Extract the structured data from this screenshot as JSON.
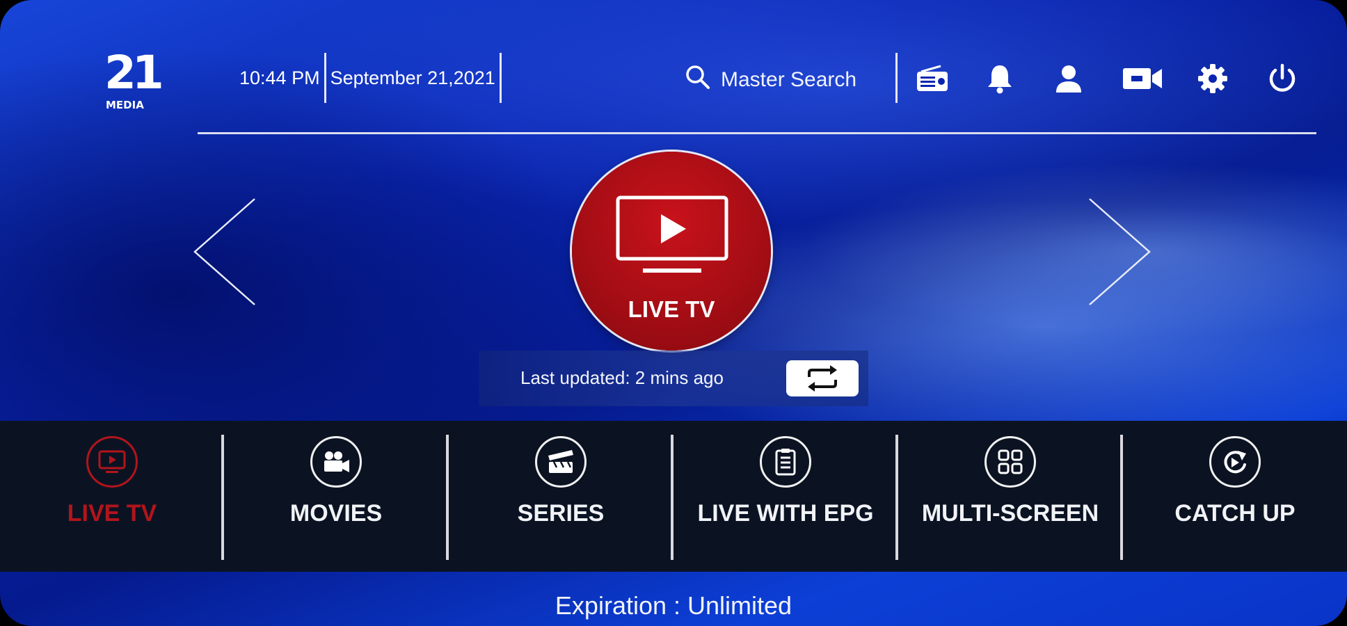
{
  "brand": {
    "logo_number": "21",
    "logo_text": "MEDIA"
  },
  "header": {
    "time": "10:44 PM",
    "date": "September 21,2021",
    "search_label": "Master Search",
    "icons": [
      "radio-icon",
      "bell-icon",
      "user-icon",
      "video-camera-icon",
      "gear-icon",
      "power-icon"
    ]
  },
  "carousel": {
    "current_label": "LIVE TV",
    "last_updated": "Last updated: 2 mins ago"
  },
  "nav": {
    "items": [
      {
        "label": "LIVE TV",
        "icon": "tv-icon",
        "active": true
      },
      {
        "label": "MOVIES",
        "icon": "movie-camera-icon",
        "active": false
      },
      {
        "label": "SERIES",
        "icon": "clapperboard-icon",
        "active": false
      },
      {
        "label": "LIVE WITH EPG",
        "icon": "epg-list-icon",
        "active": false
      },
      {
        "label": "MULTI-SCREEN",
        "icon": "grid-icon",
        "active": false
      },
      {
        "label": "CATCH UP",
        "icon": "catch-up-icon",
        "active": false
      }
    ]
  },
  "footer": {
    "expiration": "Expiration : Unlimited"
  },
  "colors": {
    "accent_red": "#b3141b",
    "navbar_bg": "#0b1323",
    "background_blue": "#0a25b0"
  }
}
